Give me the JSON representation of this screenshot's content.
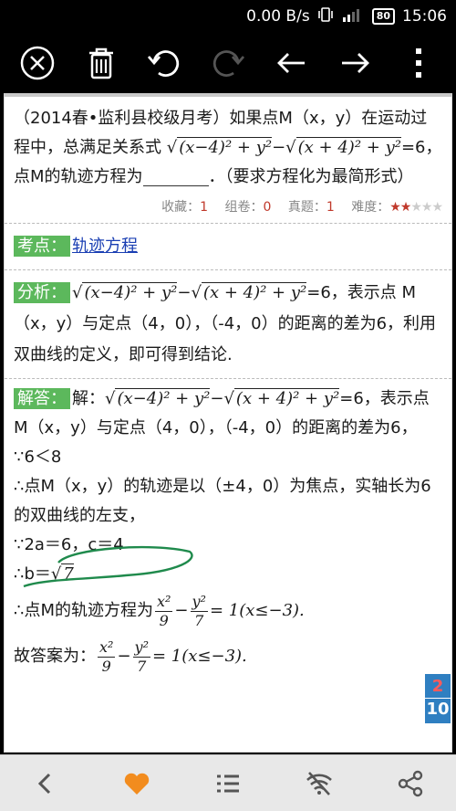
{
  "status_bar": {
    "speed": "0.00 B/s",
    "battery": "80",
    "time": "15:06"
  },
  "toolbar": {
    "icons": [
      "close-icon",
      "trash-icon",
      "undo-icon",
      "redo-icon",
      "back-arrow-icon",
      "forward-arrow-icon",
      "more-icon"
    ]
  },
  "question": {
    "prefix": "（2014春•监利县校级月考）如果点M（x，y）在运动过程中，总满足关系式",
    "suffix_equals": "=6，",
    "line2": "点M的轨迹方程为",
    "line2_end": "．（要求方程化为最简形式）"
  },
  "stats": {
    "collect_label": "收藏：",
    "collect": "1",
    "group_label": "组卷：",
    "group": "0",
    "real_label": "真题：",
    "real": "1",
    "difficulty_label": "难度：",
    "difficulty_stars_on": "★★",
    "difficulty_stars_off": "★★★"
  },
  "kaodian": {
    "tag": "考点：",
    "link": "轨迹方程"
  },
  "fenxi": {
    "tag": "分析：",
    "eq_tail": "=6，表示点",
    "text": "M（x，y）与定点（4，0），（-4，0）的距离的差为6，利用双曲线的定义，即可得到结论."
  },
  "jieda": {
    "tag": "解答：",
    "lead": "解：",
    "eq_tail": "=6，表示点",
    "text": "M（x，y）与定点（4，0），（-4，0）的距离的差为6，",
    "l1": "∵6＜8",
    "l2": "∴点M（x，y）的轨迹是以（±4，0）为焦点，实轴长为6的双曲线的左支，",
    "l3": "∵2a＝6，c＝4",
    "l4": "∴b＝",
    "l4_sqrt": "7",
    "l5": "∴点M的轨迹方程为",
    "l5_tail": "= 1(x≤−3).",
    "l6": "故答案为：",
    "l6_tail": "= 1(x≤−3)."
  },
  "math": {
    "sqrt1": "(x−4)² + y²",
    "minus": "−",
    "sqrt2": "(x + 4)² + y²",
    "frac_x_num": "x²",
    "frac_x_den": "9",
    "frac_sep": "−",
    "frac_y_num": "y²",
    "frac_y_den": "7"
  },
  "page_badge": {
    "current": "2",
    "total": "10"
  },
  "bottom_nav": {
    "icons": [
      "back-icon",
      "heart-icon",
      "list-icon",
      "wifi-off-icon",
      "share-icon"
    ]
  }
}
